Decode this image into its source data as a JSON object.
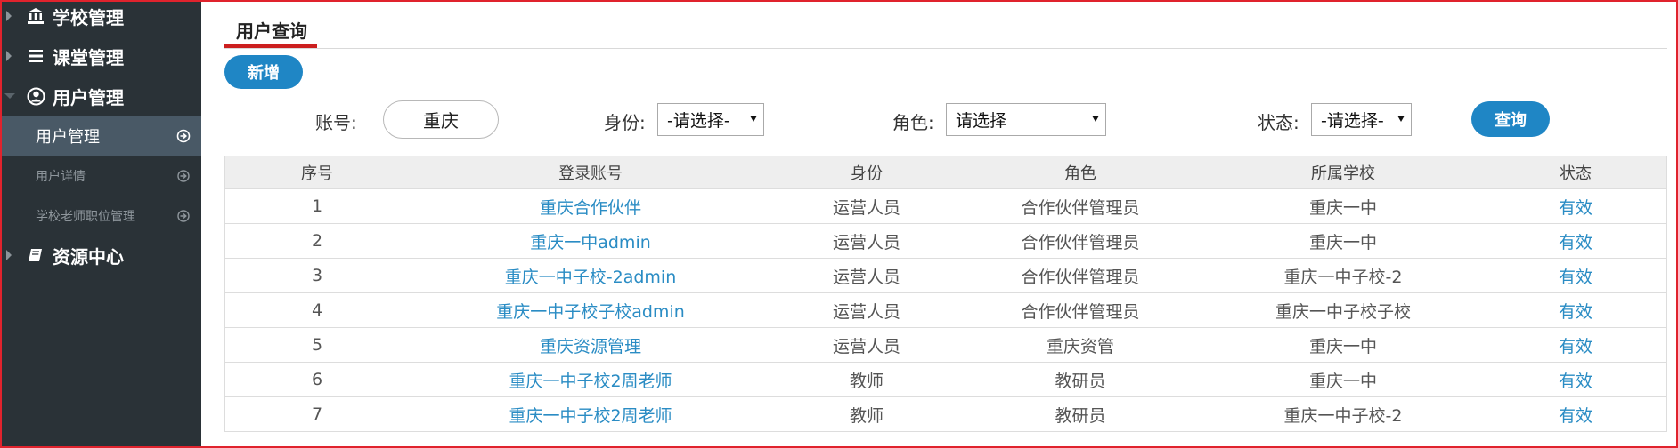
{
  "sidebar": {
    "groups": [
      {
        "label": "学校管理",
        "icon": "bank-icon"
      },
      {
        "label": "课堂管理",
        "icon": "list-icon"
      },
      {
        "label": "用户管理",
        "icon": "user-circle-icon"
      },
      {
        "label": "资源中心",
        "icon": "book-icon"
      }
    ],
    "sub_items": [
      {
        "label": "用户管理",
        "active": true
      },
      {
        "label": "用户详情",
        "active": false
      },
      {
        "label": "学校老师职位管理",
        "active": false
      }
    ]
  },
  "tab": {
    "label": "用户查询"
  },
  "toolbar": {
    "add_label": "新增",
    "search_label": "查询"
  },
  "filters": {
    "account": {
      "label": "账号:",
      "value": "重庆"
    },
    "identity": {
      "label": "身份:",
      "value": "-请选择-"
    },
    "role": {
      "label": "角色:",
      "value": "请选择"
    },
    "status": {
      "label": "状态:",
      "value": "-请选择-"
    }
  },
  "table": {
    "headers": [
      "序号",
      "登录账号",
      "身份",
      "角色",
      "所属学校",
      "状态"
    ],
    "rows": [
      [
        "1",
        "重庆合作伙伴",
        "运营人员",
        "合作伙伴管理员",
        "重庆一中",
        "有效"
      ],
      [
        "2",
        "重庆一中admin",
        "运营人员",
        "合作伙伴管理员",
        "重庆一中",
        "有效"
      ],
      [
        "3",
        "重庆一中子校-2admin",
        "运营人员",
        "合作伙伴管理员",
        "重庆一中子校-2",
        "有效"
      ],
      [
        "4",
        "重庆一中子校子校admin",
        "运营人员",
        "合作伙伴管理员",
        "重庆一中子校子校",
        "有效"
      ],
      [
        "5",
        "重庆资源管理",
        "运营人员",
        "重庆资管",
        "重庆一中",
        "有效"
      ],
      [
        "6",
        "重庆一中子校2周老师",
        "教师",
        "教研员",
        "重庆一中",
        "有效"
      ],
      [
        "7",
        "重庆一中子校2周老师",
        "教师",
        "教研员",
        "重庆一中子校-2",
        "有效"
      ]
    ]
  },
  "colors": {
    "sidebar_bg": "#2a3237",
    "active_bg": "#495966",
    "accent": "#1f86c5",
    "link": "#2a8cc4",
    "tab_underline": "#cc1f1f"
  }
}
